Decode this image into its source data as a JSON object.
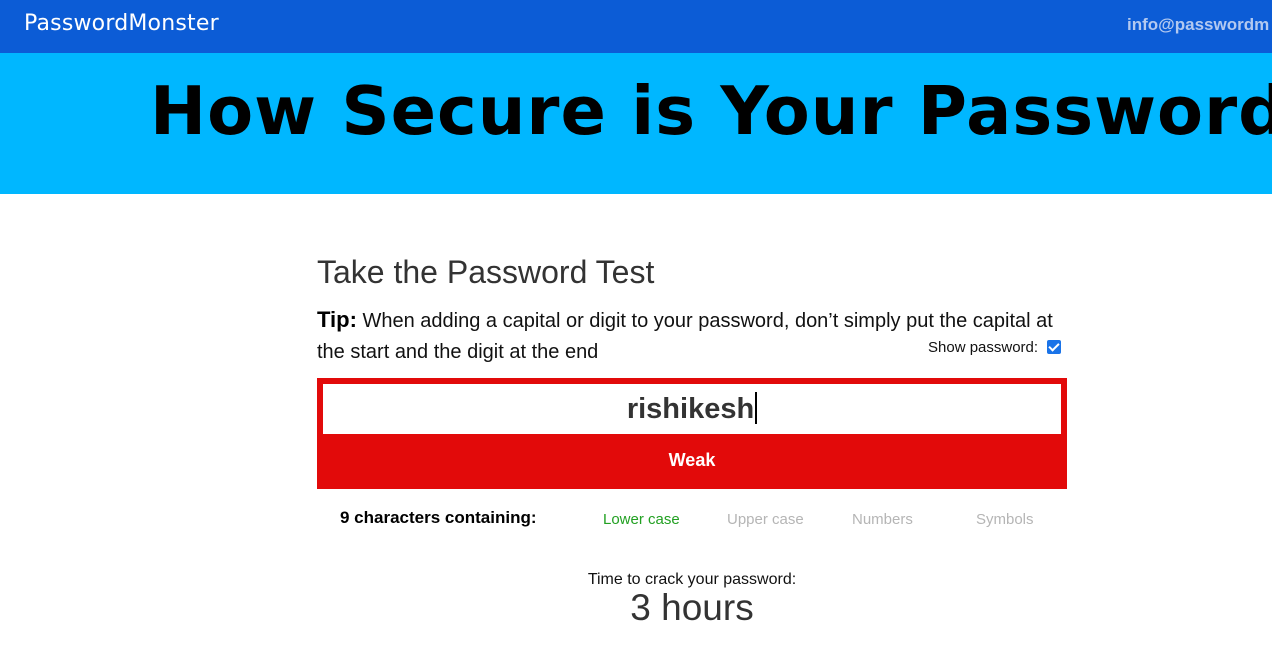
{
  "header": {
    "brand": "PasswordMonster",
    "email": "info@passwordm"
  },
  "hero": {
    "title": "How Secure is Your Password?"
  },
  "test": {
    "heading": "Take the Password Test",
    "tip_label": "Tip:",
    "tip_text": " When adding a capital or digit to your password, don’t simply put the capital at the start and the digit at the end",
    "show_password_label": "Show password:",
    "show_password_checked": true,
    "password_value": "rishikesh",
    "strength_label": "Weak",
    "strength_color": "#e20a0a",
    "char_summary": "9 characters containing:",
    "criteria": [
      {
        "label": "Lower case",
        "met": true
      },
      {
        "label": "Upper case",
        "met": false
      },
      {
        "label": "Numbers",
        "met": false
      },
      {
        "label": "Symbols",
        "met": false
      }
    ],
    "crack_label": "Time to crack your password:",
    "crack_time": "3 hours"
  },
  "colors": {
    "topbar": "#0c5cd6",
    "hero": "#00b7ff",
    "met": "#22a022",
    "unmet": "#b5b5b5"
  }
}
